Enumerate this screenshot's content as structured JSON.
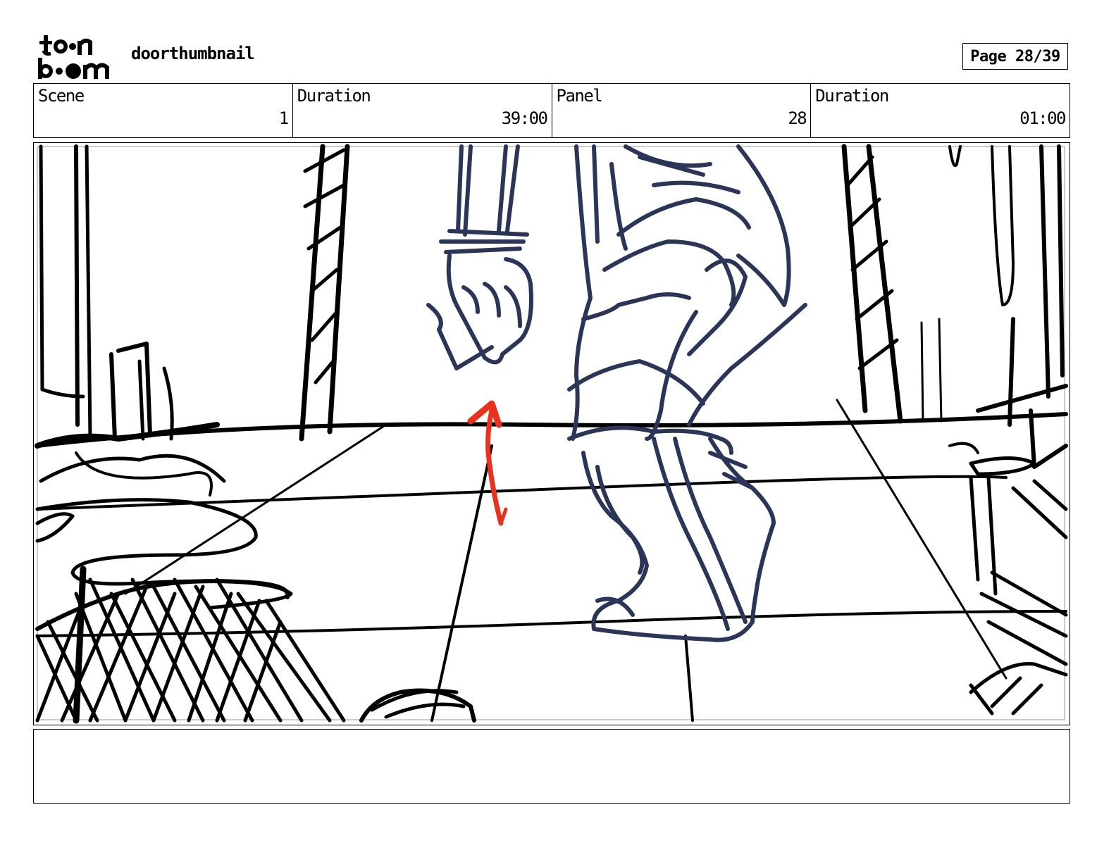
{
  "header": {
    "logo_alt": "toon boom",
    "project_title": "doorthumbnail",
    "page_label": "Page 28/39"
  },
  "info": {
    "scene_label": "Scene",
    "scene_value": "1",
    "scene_duration_label": "Duration",
    "scene_duration_value": "39:00",
    "panel_label": "Panel",
    "panel_value": "28",
    "panel_duration_label": "Duration",
    "panel_duration_value": "01:00"
  },
  "panel": {
    "description": "",
    "colors": {
      "ink": "#000000",
      "character": "#2b3558",
      "arrow": "#e8321e"
    }
  },
  "notes": {
    "text": ""
  }
}
